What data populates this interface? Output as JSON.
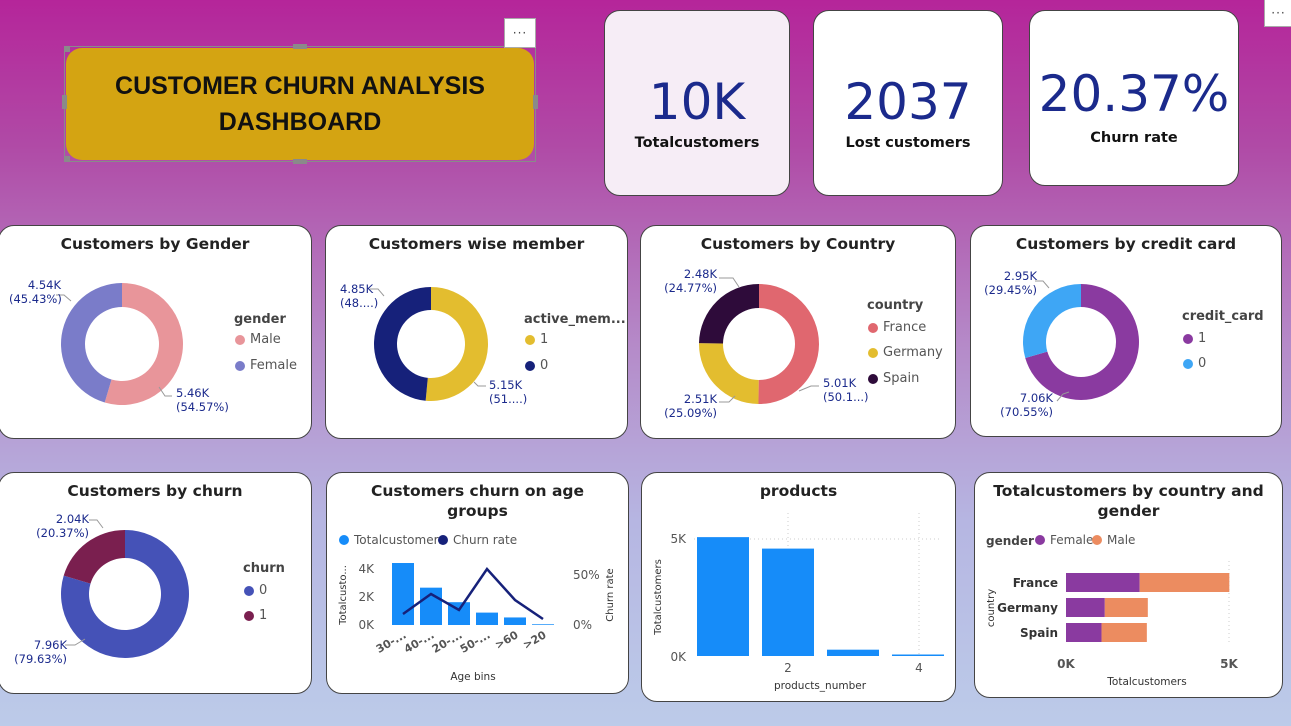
{
  "header": {
    "title_line1": "CUSTOMER CHURN ANALYSIS",
    "title_line2": "DASHBOARD",
    "more_icon": "···"
  },
  "kpis": [
    {
      "value": "10K",
      "label": "Totalcustomers"
    },
    {
      "value": "2037",
      "label": "Lost customers"
    },
    {
      "value": "20.37%",
      "label": "Churn rate"
    }
  ],
  "colors": {
    "pink": "#e8959a",
    "lavender": "#7a7cc9",
    "gold": "#e3bd2f",
    "navy": "#16217a",
    "red": "#e0676f",
    "darkPurple": "#2e0b3a",
    "violet": "#8a3aa0",
    "skyBlue": "#3ea6f5",
    "blue": "#4552b7",
    "maroon": "#7a1f4f",
    "barBlue": "#168cf9",
    "orange": "#ec8c60"
  },
  "donuts": {
    "gender": {
      "title": "Customers by Gender",
      "legend_title": "gender",
      "legend": [
        "Male",
        "Female"
      ],
      "labels": [
        [
          "4.54K",
          "(45.43%)"
        ],
        [
          "5.46K",
          "(54.57%)"
        ]
      ],
      "values": [
        54.57,
        45.43
      ]
    },
    "member": {
      "title": "Customers wise member",
      "legend_title": "active_mem...",
      "legend": [
        "1",
        "0"
      ],
      "labels": [
        [
          "4.85K",
          "(48....)"
        ],
        [
          "5.15K",
          "(51....)"
        ]
      ],
      "values": [
        51.5,
        48.5
      ]
    },
    "country": {
      "title": "Customers by Country",
      "legend_title": "country",
      "legend": [
        "France",
        "Germany",
        "Spain"
      ],
      "labels": [
        [
          "2.48K",
          "(24.77%)"
        ],
        [
          "2.51K",
          "(25.09%)"
        ],
        [
          "5.01K",
          "(50.1...)"
        ]
      ],
      "values": [
        50.14,
        25.09,
        24.77
      ]
    },
    "credit": {
      "title": "Customers by credit card",
      "legend_title": "credit_card",
      "legend": [
        "1",
        "0"
      ],
      "labels": [
        [
          "2.95K",
          "(29.45%)"
        ],
        [
          "7.06K",
          "(70.55%)"
        ]
      ],
      "values": [
        70.55,
        29.45
      ]
    },
    "churn": {
      "title": "Customers by churn",
      "legend_title": "churn",
      "legend": [
        "0",
        "1"
      ],
      "labels": [
        [
          "2.04K",
          "(20.37%)"
        ],
        [
          "7.96K",
          "(79.63%)"
        ]
      ],
      "values": [
        79.63,
        20.37
      ]
    }
  },
  "age": {
    "title_line1": "Customers churn on age",
    "title_line2": "groups",
    "legend": [
      "Totalcustomers",
      "Churn rate"
    ],
    "ylabel": "Totalcusto...",
    "y2label": "Churn rate",
    "xlabel": "Age bins",
    "yticks": [
      "4K",
      "2K",
      "0K"
    ],
    "y2ticks": [
      "50%",
      "0%"
    ]
  },
  "products": {
    "title": "products",
    "ylabel": "Totalcustomers",
    "xlabel": "products_number",
    "yticks": [
      "5K",
      "0K"
    ],
    "xticks": [
      "2",
      "4"
    ]
  },
  "countryGender": {
    "title_line1": "Totalcustomers by country and",
    "title_line2": "gender",
    "legend_title": "gender",
    "legend": [
      "Female",
      "Male"
    ],
    "ylabel": "country",
    "xlabel": "Totalcustomers",
    "xticks": [
      "0K",
      "5K"
    ]
  },
  "chart_data": [
    {
      "type": "bar",
      "title": "Customers churn on age groups",
      "xlabel": "Age bins",
      "categories": [
        "30-...",
        "40-...",
        "20-...",
        "50-...",
        ">60",
        ">20"
      ],
      "series": [
        {
          "name": "Totalcustomers",
          "values": [
            4350,
            2620,
            1600,
            870,
            530,
            50
          ]
        },
        {
          "name": "Churn rate",
          "type": "line",
          "values": [
            0.11,
            0.31,
            0.15,
            0.56,
            0.25,
            0.06
          ]
        }
      ],
      "ylim": [
        0,
        5000
      ],
      "y2lim": [
        0,
        0.75
      ]
    },
    {
      "type": "bar",
      "title": "products",
      "xlabel": "products_number",
      "ylabel": "Totalcustomers",
      "categories": [
        1,
        2,
        3,
        4
      ],
      "values": [
        5080,
        4590,
        270,
        60
      ],
      "ylim": [
        0,
        6000
      ]
    },
    {
      "type": "bar",
      "title": "Totalcustomers by country and gender",
      "orientation": "horizontal",
      "categories": [
        "France",
        "Germany",
        "Spain"
      ],
      "series": [
        {
          "name": "Female",
          "values": [
            2260,
            1190,
            1090
          ]
        },
        {
          "name": "Male",
          "values": [
            2750,
            1320,
            1390
          ]
        }
      ],
      "xlim": [
        0,
        5000
      ]
    }
  ]
}
